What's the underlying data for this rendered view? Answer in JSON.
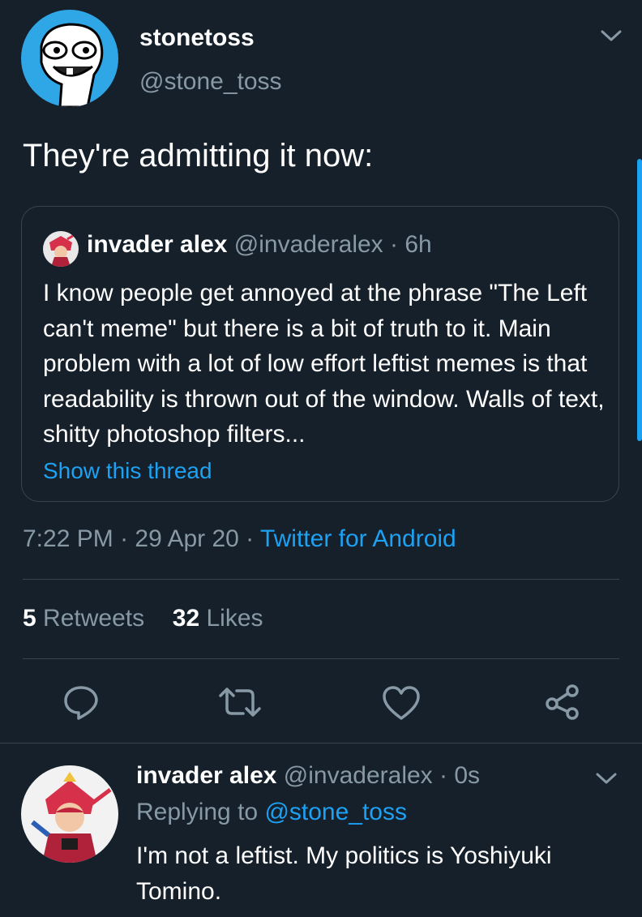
{
  "tweet": {
    "display_name": "stonetoss",
    "handle": "@stone_toss",
    "text": "They're admitting it now:",
    "time": "7:22 PM",
    "separator": " · ",
    "date": "29 Apr 20",
    "source": "Twitter for Android"
  },
  "quote": {
    "display_name": "invader alex",
    "handle": "@invaderalex",
    "age": "· 6h",
    "text": "I know people get annoyed at the phrase \"The Left can't meme\" but there is a bit of truth to it. Main problem with a lot of low effort leftist memes is that readability is thrown out of the window. Walls of text, shitty photoshop filters...",
    "show_thread": "Show this thread"
  },
  "stats": {
    "retweets_count": "5",
    "retweets_label": "Retweets",
    "likes_count": "32",
    "likes_label": "Likes"
  },
  "actions": [
    {
      "icon": "reply-icon"
    },
    {
      "icon": "retweet-icon"
    },
    {
      "icon": "like-icon"
    },
    {
      "icon": "share-icon"
    }
  ],
  "reply": {
    "display_name": "invader alex",
    "handle": "@invaderalex",
    "age": "· 0s",
    "replying_to_label": "Replying to",
    "replying_to_handle": "@stone_toss",
    "text": "I'm not a leftist. My politics is Yoshiyuki Tomino."
  },
  "colors": {
    "background": "#15202b",
    "accent": "#1da1f2",
    "muted": "#8899a6",
    "divider": "#38444d"
  }
}
